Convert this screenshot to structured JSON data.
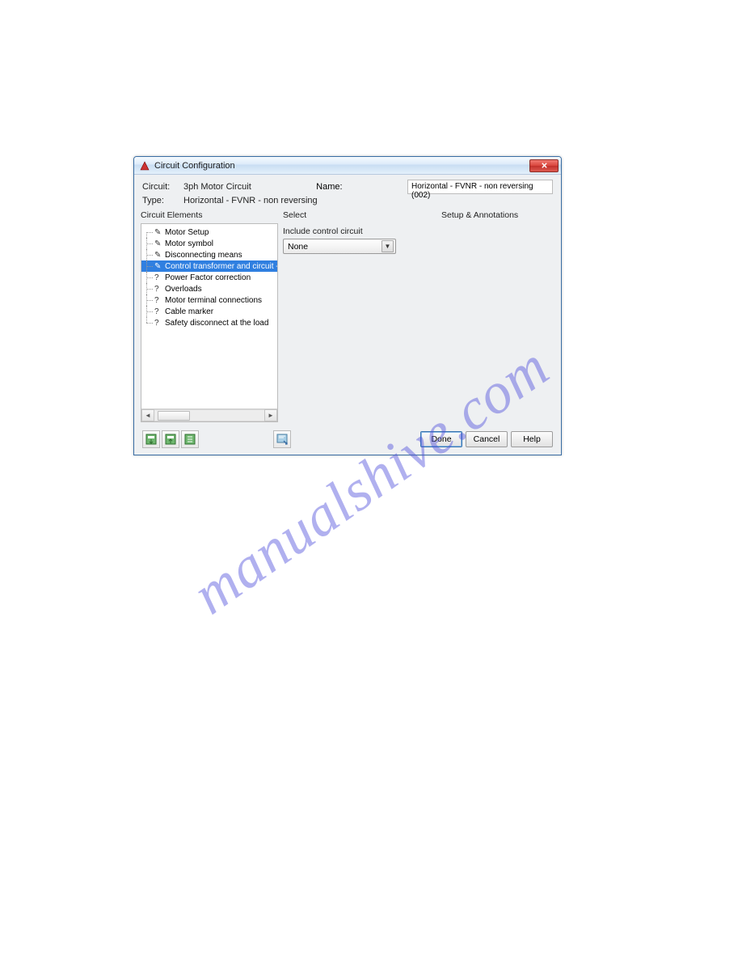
{
  "watermark": "manualshive.com",
  "titlebar": {
    "title": "Circuit Configuration"
  },
  "header": {
    "circuit_label": "Circuit:",
    "circuit_value": "3ph Motor Circuit",
    "type_label": "Type:",
    "type_value": "Horizontal - FVNR - non reversing",
    "name_label": "Name:",
    "name_value": "Horizontal - FVNR - non reversing (002)"
  },
  "panels": {
    "elements_label": "Circuit Elements",
    "select_label": "Select",
    "annotations_label": "Setup & Annotations"
  },
  "tree": {
    "items": [
      {
        "icon": "✎",
        "label": "Motor Setup"
      },
      {
        "icon": "✎",
        "label": "Motor symbol"
      },
      {
        "icon": "✎",
        "label": "Disconnecting means"
      },
      {
        "icon": "✎",
        "label": "Control transformer and circuit - n",
        "selected": true
      },
      {
        "icon": "?",
        "label": "Power Factor correction"
      },
      {
        "icon": "?",
        "label": "Overloads"
      },
      {
        "icon": "?",
        "label": "Motor terminal connections"
      },
      {
        "icon": "?",
        "label": "Cable marker"
      },
      {
        "icon": "?",
        "label": "Safety disconnect at the load"
      }
    ],
    "scroll_thumb_label": "III"
  },
  "select_panel": {
    "include_label": "Include control circuit",
    "dropdown_value": "None"
  },
  "buttons": {
    "done": "Done",
    "cancel": "Cancel",
    "help": "Help"
  }
}
